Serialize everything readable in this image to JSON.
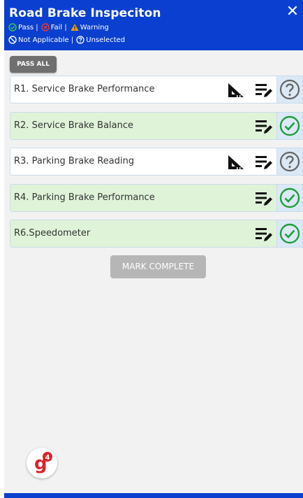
{
  "header": {
    "title": "Road Brake Inspeciton",
    "close_glyph": "✕",
    "legend": {
      "pass": "Pass |",
      "fail": "Fail |",
      "warning": "Warning",
      "not_applicable": "Not Applicable |",
      "unselected": "Unselected"
    }
  },
  "pass_all_label": "PASS ALL",
  "rows": [
    {
      "label": "R1. Service Brake Performance",
      "status": "unselected",
      "has_ruler": true
    },
    {
      "label": "R2. Service Brake Balance",
      "status": "pass",
      "has_ruler": false
    },
    {
      "label": "R3. Parking Brake Reading",
      "status": "unselected",
      "has_ruler": true
    },
    {
      "label": "R4. Parking Brake Performance",
      "status": "pass",
      "has_ruler": false
    },
    {
      "label": "R6.Speedometer",
      "status": "pass",
      "has_ruler": false
    }
  ],
  "mark_complete_label": "MARK COMPLETE",
  "logo": {
    "letter": "g",
    "badge": "4"
  },
  "colors": {
    "header": "#0a3fcf",
    "pass_green": "#1f9e3a",
    "fail_red": "#e53935",
    "warning_orange": "#f5a300",
    "row_green": "#dff3d9",
    "logo_red": "#d8232a"
  }
}
